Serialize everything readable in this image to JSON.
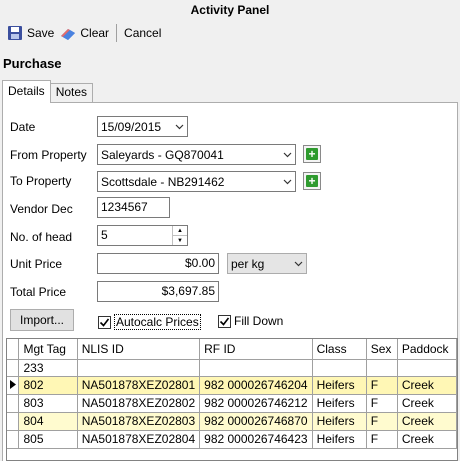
{
  "window": {
    "title": "Activity Panel"
  },
  "toolbar": {
    "save_label": "Save",
    "clear_label": "Clear",
    "cancel_label": "Cancel"
  },
  "section": {
    "title": "Purchase"
  },
  "tabs": [
    {
      "label": "Details",
      "active": true
    },
    {
      "label": "Notes",
      "active": false
    }
  ],
  "form": {
    "date_label": "Date",
    "date_value": "15/09/2015",
    "from_property_label": "From Property",
    "from_property_value": "Saleyards - GQ870041",
    "to_property_label": "To Property",
    "to_property_value": "Scottsdale - NB291462",
    "vendor_dec_label": "Vendor Dec",
    "vendor_dec_value": "1234567",
    "no_of_head_label": "No. of head",
    "no_of_head_value": "5",
    "unit_price_label": "Unit Price",
    "unit_price_value": "$0.00",
    "unit_price_unit": "per kg",
    "total_price_label": "Total Price",
    "total_price_value": "$3,697.85",
    "import_label": "Import...",
    "autocalc_label": "Autocalc Prices",
    "autocalc_checked": true,
    "fill_down_label": "Fill Down",
    "fill_down_checked": true
  },
  "grid": {
    "columns": [
      "Mgt Tag",
      "NLIS ID",
      "RF ID",
      "Class",
      "Sex",
      "Paddock"
    ],
    "filter_row": [
      "233",
      "",
      "",
      "",
      "",
      ""
    ],
    "rows": [
      [
        "802",
        "NA501878XEZ02801",
        "982 000026746204",
        "Heifers",
        "F",
        "Creek"
      ],
      [
        "803",
        "NA501878XEZ02802",
        "982 000026746212",
        "Heifers",
        "F",
        "Creek"
      ],
      [
        "804",
        "NA501878XEZ02803",
        "982 000026746870",
        "Heifers",
        "F",
        "Creek"
      ],
      [
        "805",
        "NA501878XEZ02804",
        "982 000026746423",
        "Heifers",
        "F",
        "Creek"
      ]
    ],
    "current_row": 0,
    "highlighted_rows": [
      0,
      2
    ]
  },
  "colors": {
    "row_highlight": "#fffbcf",
    "plus_green": "#2f9b2f"
  }
}
